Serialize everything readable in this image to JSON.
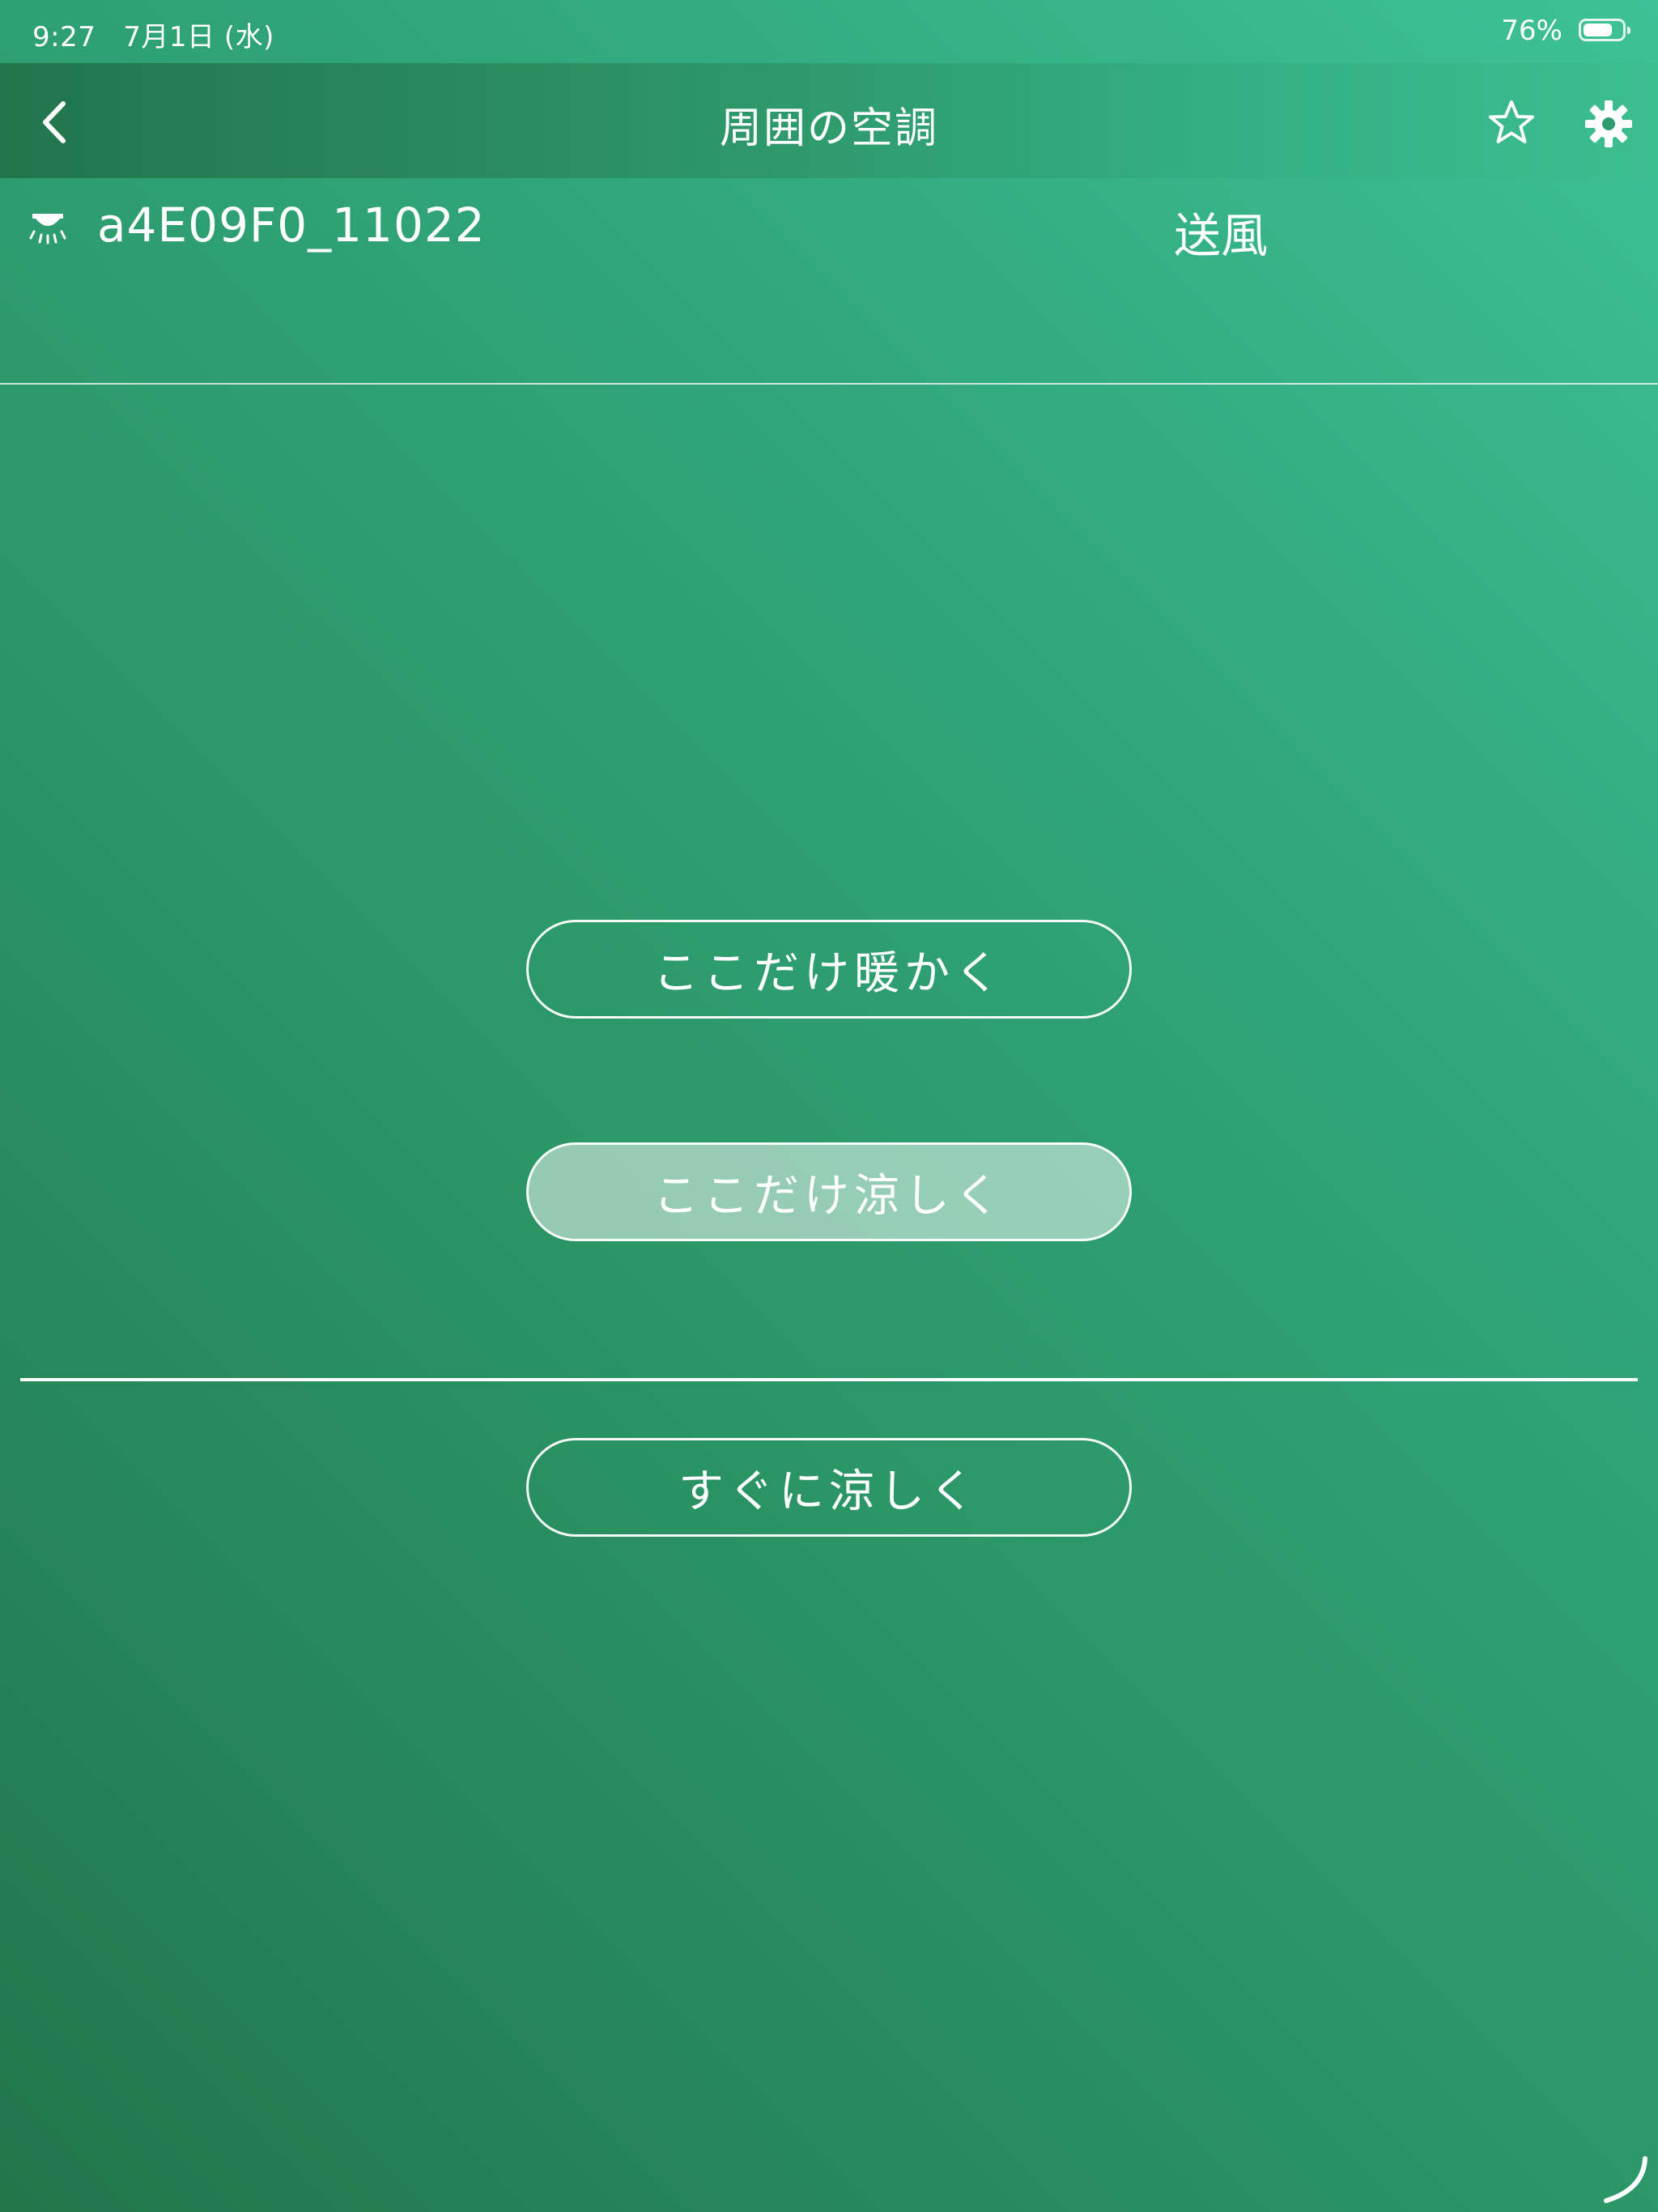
{
  "status_bar": {
    "time": "9:27",
    "date": "7月1日 (水)",
    "battery_percent": "76%",
    "battery_level": 0.76
  },
  "nav": {
    "title": "周囲の空調",
    "back_icon": "chevron-left-icon",
    "favorite_icon": "star-outline-icon",
    "settings_icon": "gear-icon"
  },
  "device": {
    "icon": "ceiling-ac-icon",
    "name": "a4E09F0_11022",
    "mode": "送風"
  },
  "actions": {
    "warm_label": "ここだけ暖かく",
    "cool_label": "ここだけ涼しく",
    "quick_cool_label": "すぐに涼しく",
    "selected": "cool"
  },
  "colors": {
    "gradient_light": "#3ec196",
    "gradient_dark": "#21764a",
    "text": "#ffffff"
  }
}
